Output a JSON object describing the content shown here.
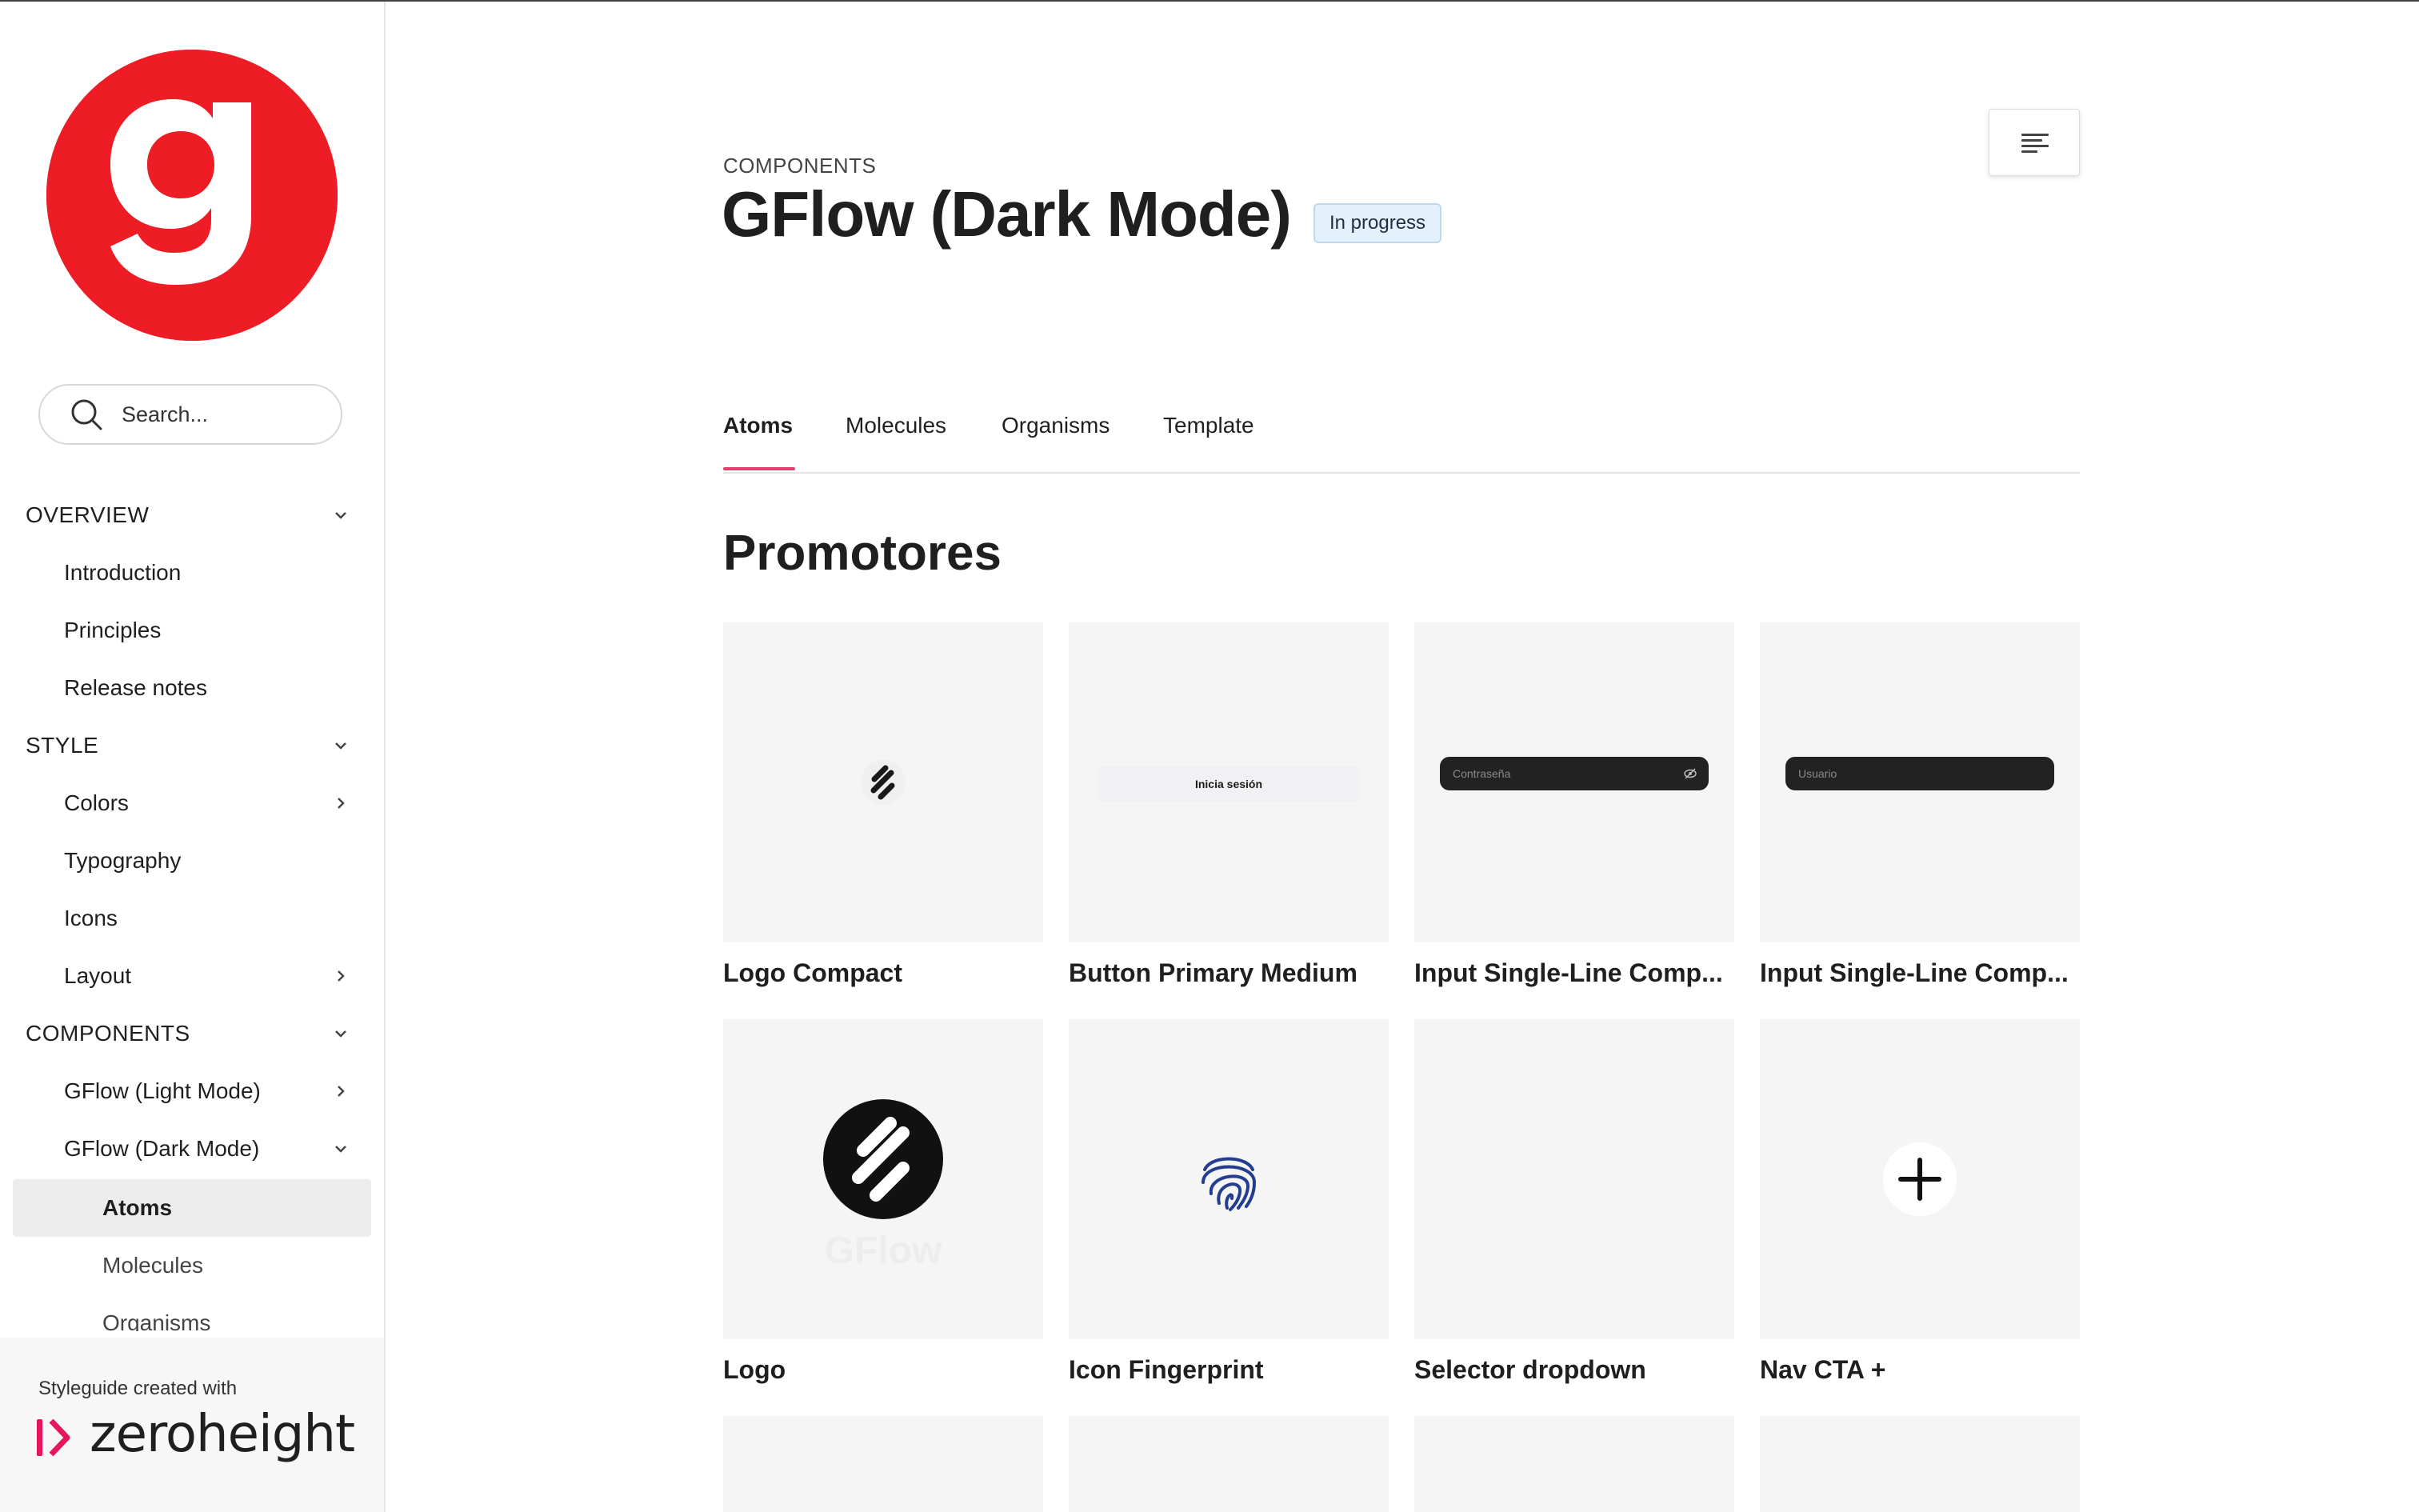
{
  "colors": {
    "brand_red": "#ee1c25",
    "accent_pink": "#e93c6c",
    "badge_bg": "#e4f0fb",
    "card_bg": "#f5f5f5"
  },
  "sidebar": {
    "logo_icon": "brand-g-logo",
    "search": {
      "placeholder": "Search..."
    },
    "nav": {
      "overview": "OVERVIEW",
      "introduction": "Introduction",
      "principles": "Principles",
      "release_notes": "Release notes",
      "style": "STYLE",
      "colors": "Colors",
      "typography": "Typography",
      "icons": "Icons",
      "layout": "Layout",
      "components": "COMPONENTS",
      "gflow_light": "GFlow (Light Mode)",
      "gflow_dark": "GFlow (Dark Mode)",
      "atoms": "Atoms",
      "molecules": "Molecules",
      "organisms": "Organisms"
    },
    "footer": {
      "caption": "Styleguide created with",
      "brand": "zeroheight"
    }
  },
  "header": {
    "eyebrow": "COMPONENTS",
    "title": "GFlow (Dark Mode)",
    "status_badge": "In progress",
    "toc_icon": "table-of-contents-icon"
  },
  "tabs": {
    "atoms": "Atoms",
    "molecules": "Molecules",
    "organisms": "Organisms",
    "template": "Template",
    "active": "Atoms"
  },
  "section": {
    "title": "Promotores"
  },
  "cards": [
    {
      "label": "Logo Compact"
    },
    {
      "label": "Button Primary Medium",
      "preview_text": "Inicia sesión"
    },
    {
      "label": "Input Single-Line Comp...",
      "preview_text": "Contraseña"
    },
    {
      "label": "Input Single-Line Comp...",
      "preview_text": "Usuario"
    },
    {
      "label": "Logo",
      "preview_text": "GFlow"
    },
    {
      "label": "Icon Fingerprint"
    },
    {
      "label": "Selector dropdown"
    },
    {
      "label": "Nav CTA +"
    }
  ]
}
